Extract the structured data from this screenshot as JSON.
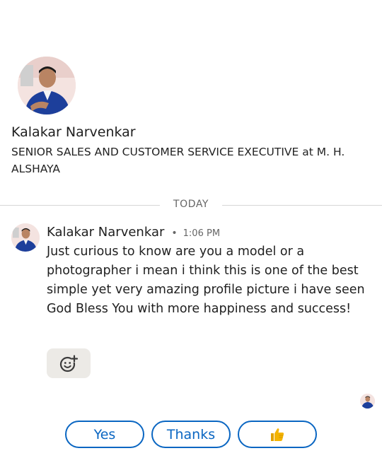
{
  "profile": {
    "name": "Kalakar Narvenkar",
    "headline": "SENIOR SALES AND CUSTOMER SERVICE EXECUTIVE at M. H. ALSHAYA"
  },
  "divider": {
    "label": "TODAY"
  },
  "message": {
    "sender": "Kalakar Narvenkar",
    "separator": "•",
    "time": "1:06 PM",
    "body": "Just curious to know are you a model or a photographer i mean i think this is one of the best simple yet very amazing profile picture i have seen God Bless You with more happiness and success!"
  },
  "icons": {
    "react": "add-reaction-icon",
    "thumb": "thumbs-up-icon"
  },
  "quick_replies": {
    "yes": "Yes",
    "thanks": "Thanks",
    "thumb_icon": "thumbs-up-icon"
  },
  "colors": {
    "accent": "#0a66c2",
    "thumb": "#f4b400",
    "jacket": "#1d3f9b"
  }
}
